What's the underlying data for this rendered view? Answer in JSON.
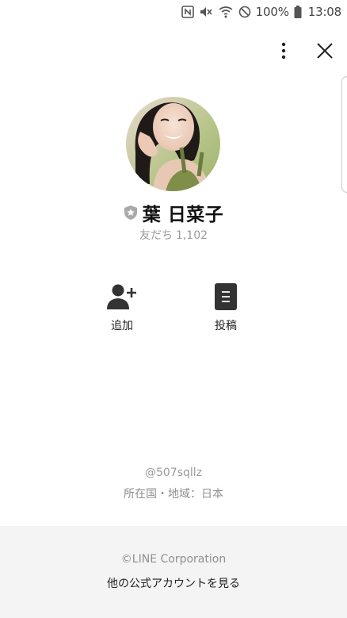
{
  "status_bar": {
    "battery": "100%",
    "time": "13:08",
    "icons": [
      "nfc-icon",
      "mute-icon",
      "wifi-icon",
      "block-icon",
      "battery-icon"
    ]
  },
  "header": {
    "more_icon": "more-vertical-icon",
    "close_icon": "close-icon"
  },
  "profile": {
    "name": "葉 日菜子",
    "friends_label": "友だち",
    "friends_count": "1,102",
    "badge_icon": "shield-star-icon"
  },
  "actions": [
    {
      "label": "追加",
      "icon": "add-friend-icon"
    },
    {
      "label": "投稿",
      "icon": "post-icon"
    }
  ],
  "info": {
    "account_id": "@507sqllz",
    "region": "所在国・地域：日本"
  },
  "footer": {
    "copyright": "©LINE Corporation",
    "more_accounts": "他の公式アカウントを見る"
  },
  "colors": {
    "footer_bg": "#f4f4f4",
    "muted_text": "#9a9a9a",
    "icon_dark": "#333333",
    "badge_grey": "#a9a9a9"
  }
}
